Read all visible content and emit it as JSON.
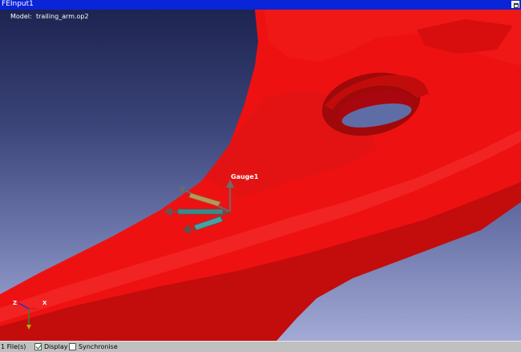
{
  "window": {
    "title": "FEInput1"
  },
  "viewport": {
    "model_label": "Model:",
    "model_file": "trailing_arm.op2",
    "gauge_name": "Gauge1",
    "axis_z": "Z",
    "axis_x": "X"
  },
  "statusbar": {
    "files": "1 File(s)",
    "display_label": "Display",
    "display_checked": true,
    "sync_label": "Synchronise",
    "sync_checked": false
  },
  "colors": {
    "part": "#ee1111",
    "title_bar": "#0a24d8"
  }
}
